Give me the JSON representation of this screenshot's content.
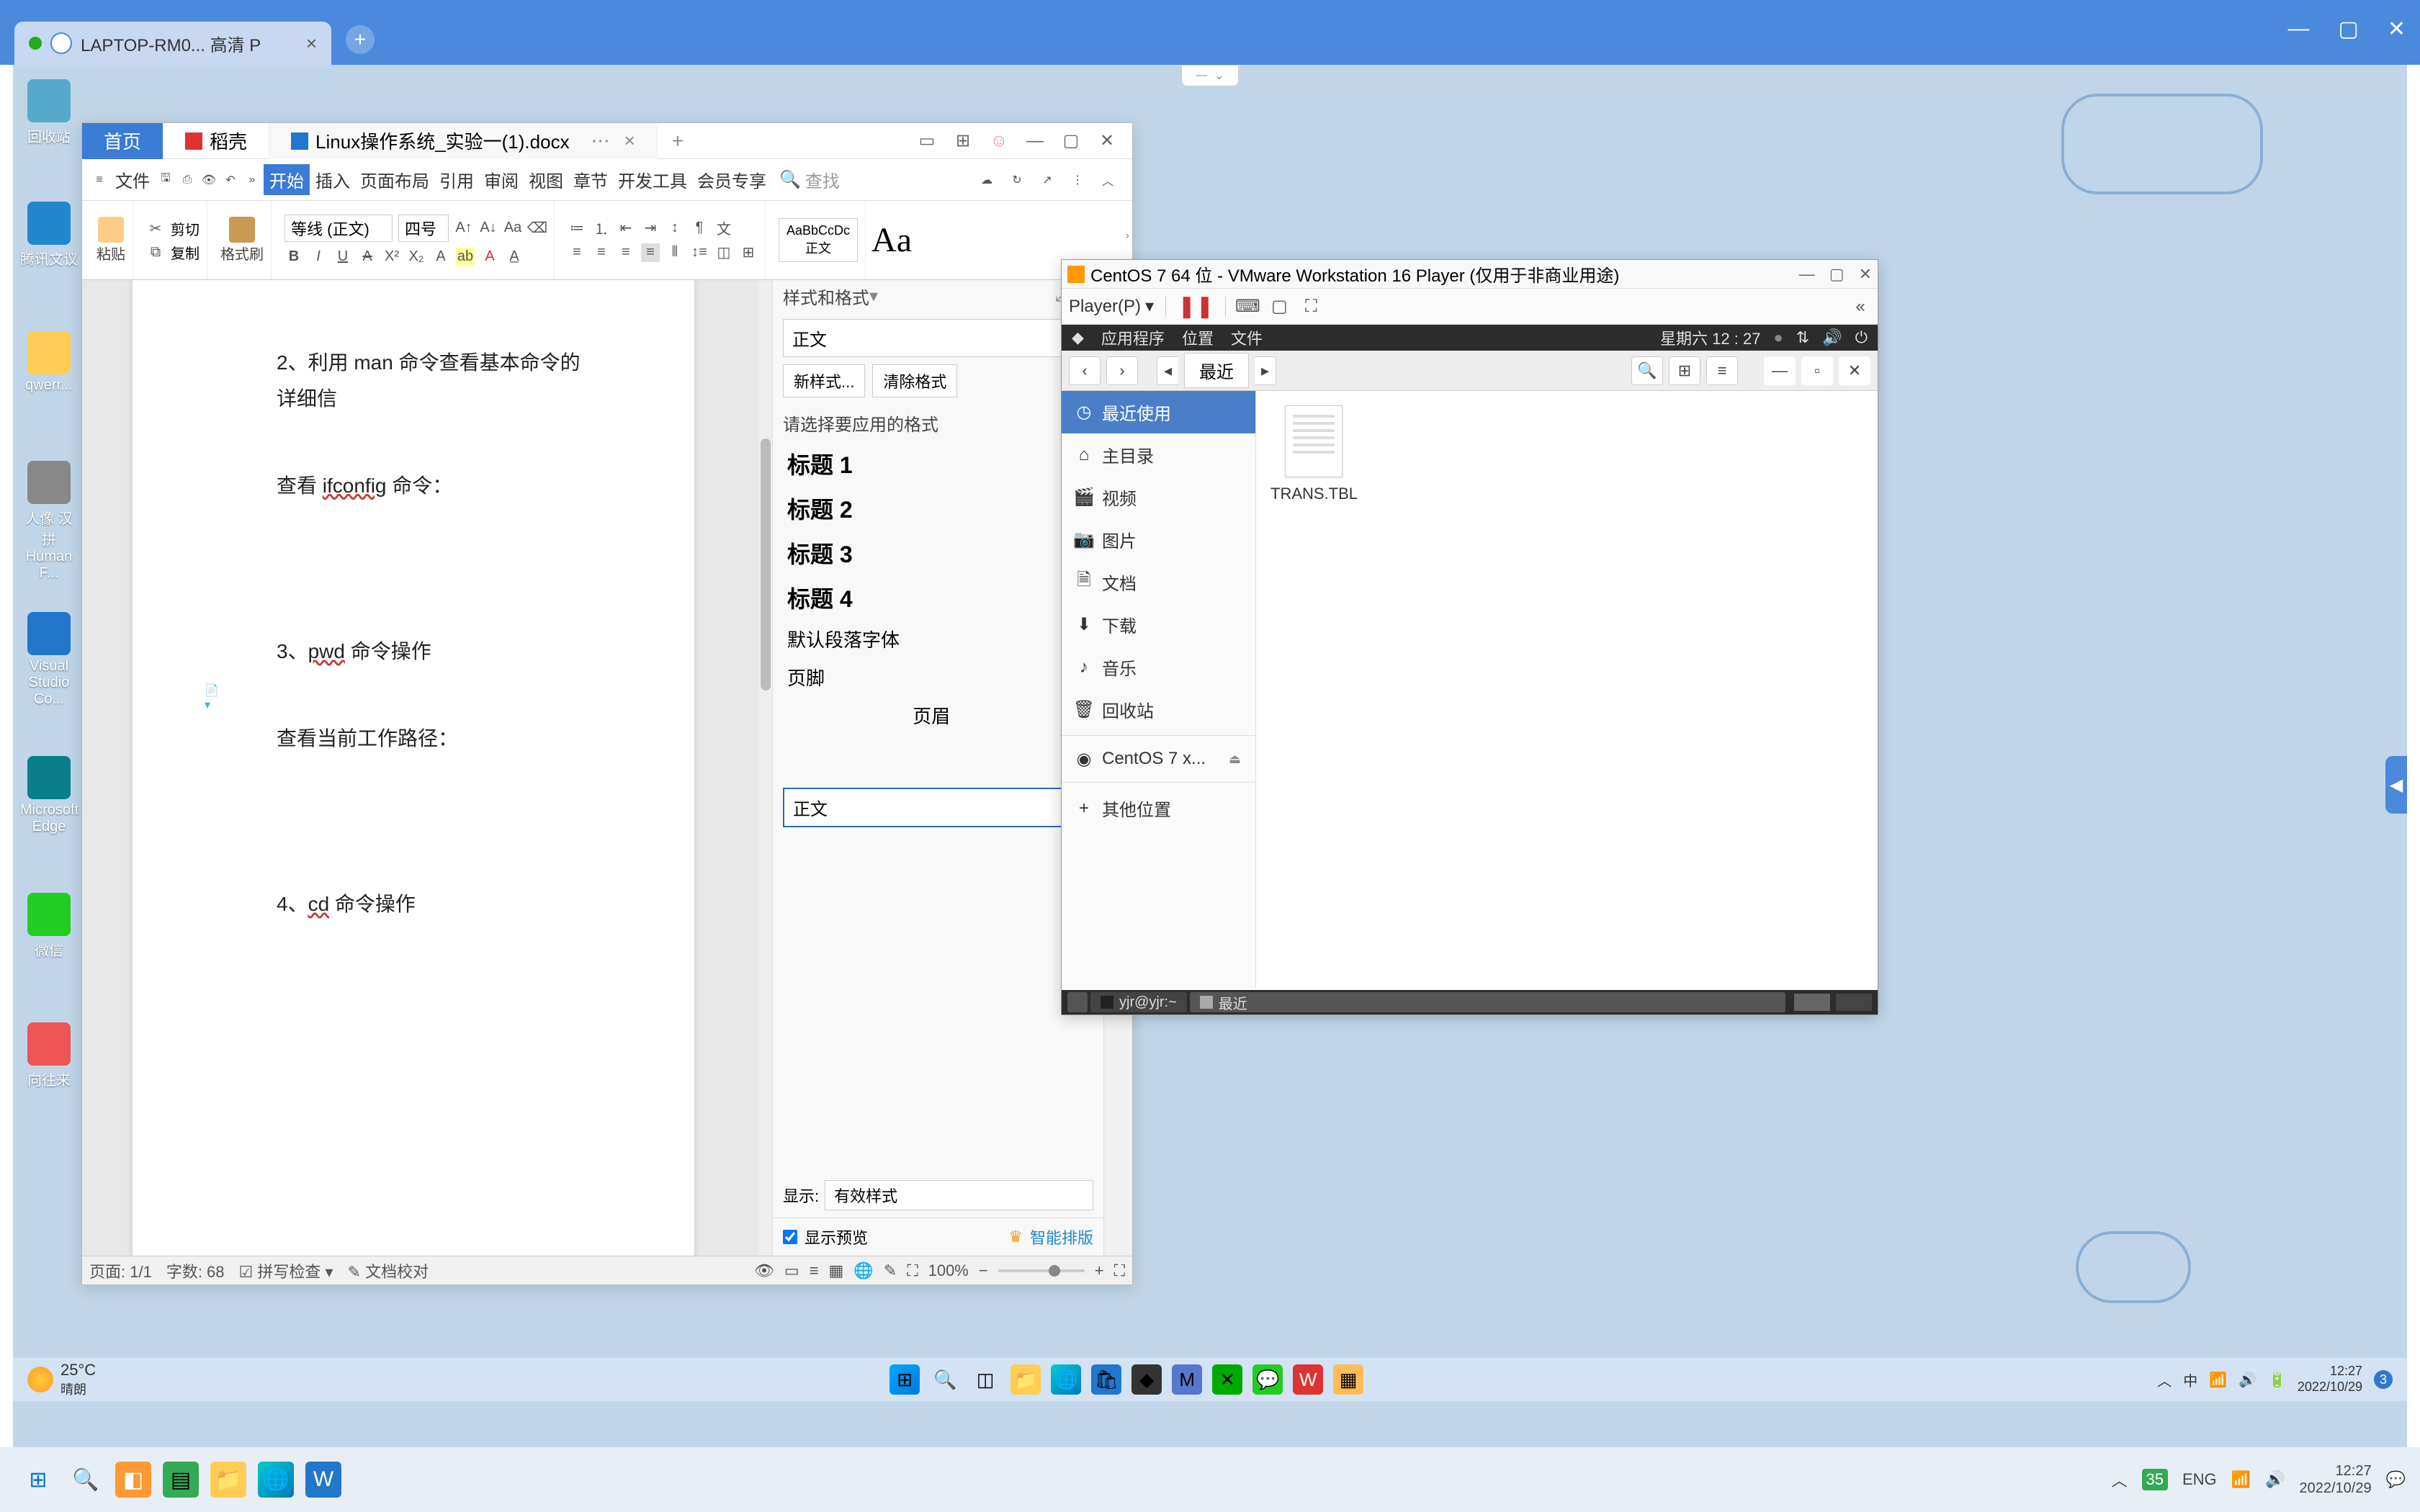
{
  "outer_browser": {
    "tab_title": "LAPTOP-RM0...  高清        P",
    "new_tab": "+"
  },
  "desktop_icons": {
    "recycle": "回收站",
    "tencent": "腾讯文议",
    "folder": "qwerr...",
    "photos": "人像 汉拼 Human F...",
    "vscode": "Visual Studio Co...",
    "edge": "Microsoft Edge",
    "wechat": "微信",
    "todesk": "向往来"
  },
  "wps": {
    "tab_home": "首页",
    "tab_shell": "稻壳",
    "tab_doc": "Linux操作系统_实验一(1).docx",
    "menu_file": "文件",
    "menu_start": "开始",
    "menu_insert": "插入",
    "menu_layout": "页面布局",
    "menu_ref": "引用",
    "menu_review": "审阅",
    "menu_view": "视图",
    "menu_chapter": "章节",
    "menu_devtools": "开发工具",
    "menu_member": "会员专享",
    "search_ph": "查找",
    "ribbon_paste": "粘贴",
    "ribbon_cut": "剪切",
    "ribbon_copy": "复制",
    "ribbon_brush": "格式刷",
    "font_name": "等线 (正文)",
    "font_size": "四号",
    "style_normal_box": "AaBbCcDc",
    "style_normal_lbl": "正文",
    "doc_line1": "2、利用 man 命令查看基本命令的详细信",
    "doc_line2_pre": "查看 ",
    "doc_line2_word": "ifconfig",
    "doc_line2_post": " 命令：",
    "doc_line3_pre": "3、",
    "doc_line3_word": "pwd",
    "doc_line3_post": " 命令操作",
    "doc_line4": "查看当前工作路径：",
    "doc_line5_pre": "4、",
    "doc_line5_word": "cd",
    "doc_line5_post": " 命令操作",
    "style_panel_title": "样式和格式",
    "style_current": "正文",
    "btn_new_style": "新样式...",
    "btn_clear_fmt": "清除格式",
    "style_choose": "请选择要应用的格式",
    "style_h1": "标题 1",
    "style_h2": "标题 2",
    "style_h3": "标题 3",
    "style_h4": "标题 4",
    "style_default_font": "默认段落字体",
    "style_footer": "页脚",
    "style_header": "页眉",
    "style_input_val": "正文",
    "show_lbl": "显示:",
    "show_val": "有效样式",
    "preview_chk": "显示预览",
    "smart_layout": "智能排版",
    "status_page": "页面: 1/1",
    "status_words": "字数: 68",
    "status_spell": "拼写检查",
    "status_proof": "文档校对",
    "zoom_val": "100%"
  },
  "vmware": {
    "title": "CentOS 7 64 位 - VMware Workstation 16 Player (仅用于非商业用途)",
    "player_btn": "Player(P)",
    "gnome_apps": "应用程序",
    "gnome_places": "位置",
    "gnome_files": "文件",
    "gnome_date": "星期六 12 : 27",
    "files_loc": "最近",
    "side_recent": "最近使用",
    "side_home": "主目录",
    "side_video": "视频",
    "side_pictures": "图片",
    "side_docs": "文档",
    "side_downloads": "下载",
    "side_music": "音乐",
    "side_trash": "回收站",
    "side_centos": "CentOS 7 x...",
    "side_other": "其他位置",
    "file_name": "TRANS.TBL",
    "task_terminal": "yjr@yjr:~",
    "task_recent": "最近"
  },
  "inner_taskbar": {
    "weather_temp": "25°C",
    "weather_cond": "晴朗",
    "time": "12:27",
    "date": "2022/10/29",
    "ime": "中",
    "notif_count": "3"
  },
  "host_taskbar": {
    "ime_num": "35",
    "ime_lang": "ENG",
    "time": "12:27",
    "date": "2022/10/29"
  }
}
